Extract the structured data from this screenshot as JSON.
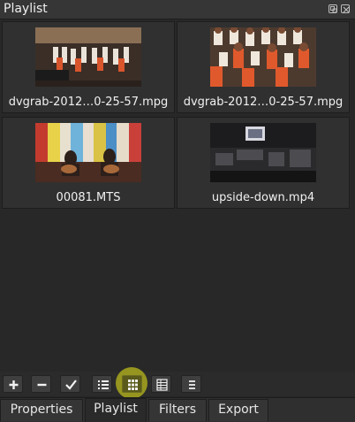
{
  "window": {
    "title": "Playlist"
  },
  "playlist": {
    "items": [
      {
        "label": "dvgrab-2012…0-25-57.mpg"
      },
      {
        "label": "dvgrab-2012…0-25-57.mpg"
      },
      {
        "label": "00081.MTS"
      },
      {
        "label": "upside-down.mp4"
      }
    ]
  },
  "toolbar": {
    "buttons": [
      "plus-icon",
      "minus-icon",
      "checkmark-icon",
      "list-view-icon",
      "tiles-view-icon",
      "icons-view-icon",
      "menu-icon"
    ],
    "active": "tiles-view-icon",
    "highlight_color": "#a8a81e"
  },
  "tabs": [
    {
      "label": "Properties"
    },
    {
      "label": "Playlist"
    },
    {
      "label": "Filters"
    },
    {
      "label": "Export"
    }
  ],
  "selected_tab": "Playlist"
}
